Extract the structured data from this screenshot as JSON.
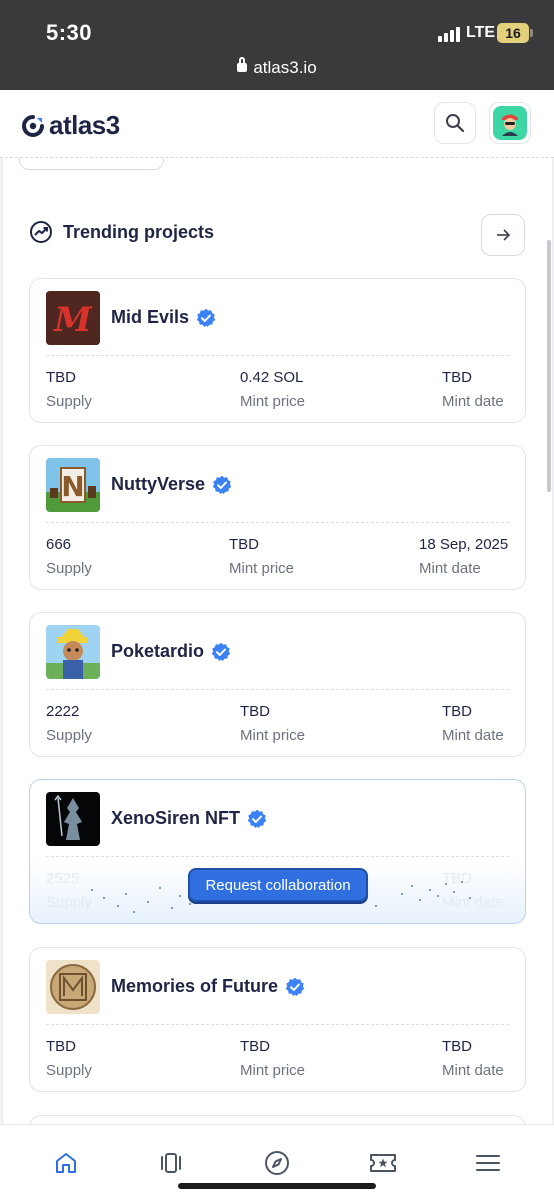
{
  "status_bar": {
    "time": "5:30",
    "network": "LTE",
    "battery": "16"
  },
  "browser": {
    "url": "atlas3.io"
  },
  "header": {
    "logo_text": "atlas3",
    "search_icon": "search-icon",
    "avatar_icon": "user-avatar"
  },
  "section": {
    "title": "Trending projects",
    "icon": "trending-up-icon",
    "arrow_icon": "arrow-right-icon"
  },
  "projects": [
    {
      "name": "Mid Evils",
      "verified": true,
      "stats": [
        {
          "value": "TBD",
          "label": "Supply"
        },
        {
          "value": "0.42 SOL",
          "label": "Mint price"
        },
        {
          "value": "TBD",
          "label": "Mint date"
        }
      ]
    },
    {
      "name": "NuttyVerse",
      "verified": true,
      "stats": [
        {
          "value": "666",
          "label": "Supply"
        },
        {
          "value": "TBD",
          "label": "Mint price"
        },
        {
          "value": "18 Sep, 2025",
          "label": "Mint date"
        }
      ]
    },
    {
      "name": "Poketardio",
      "verified": true,
      "stats": [
        {
          "value": "2222",
          "label": "Supply"
        },
        {
          "value": "TBD",
          "label": "Mint price"
        },
        {
          "value": "TBD",
          "label": "Mint date"
        }
      ]
    },
    {
      "name": "XenoSiren NFT",
      "verified": true,
      "cta": "Request collaboration",
      "stats": [
        {
          "value": "2525",
          "label": "Supply"
        },
        {
          "value": "",
          "label": ""
        },
        {
          "value": "TBD",
          "label": "Mint date"
        }
      ]
    },
    {
      "name": "Memories of Future",
      "verified": true,
      "stats": [
        {
          "value": "TBD",
          "label": "Supply"
        },
        {
          "value": "TBD",
          "label": "Mint price"
        },
        {
          "value": "TBD",
          "label": "Mint date"
        }
      ]
    }
  ],
  "bottom_nav": [
    {
      "icon": "home-icon",
      "active": true
    },
    {
      "icon": "cards-icon",
      "active": false
    },
    {
      "icon": "compass-icon",
      "active": false
    },
    {
      "icon": "ticket-star-icon",
      "active": false
    },
    {
      "icon": "menu-icon",
      "active": false
    }
  ],
  "colors": {
    "accent": "#2f6fe0",
    "verified": "#3b82f6",
    "text": "#1f2544",
    "muted": "#6b7280"
  }
}
